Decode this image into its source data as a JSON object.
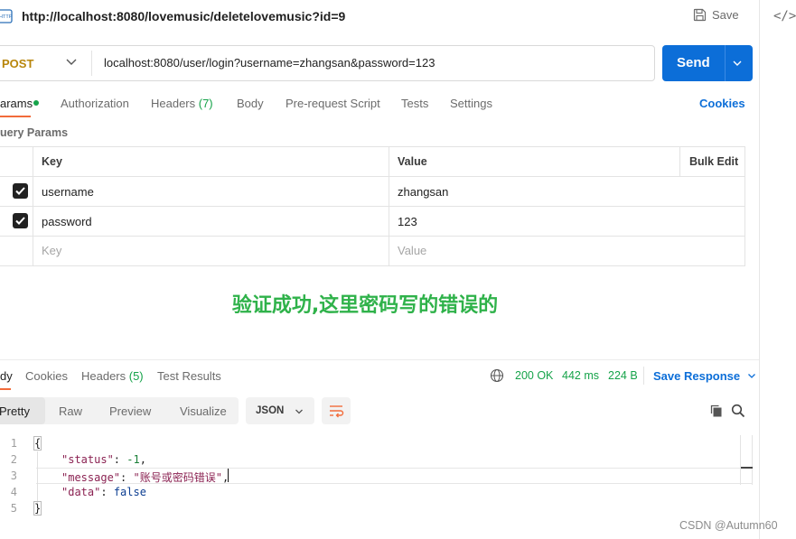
{
  "header": {
    "title": "http://localhost:8080/lovemusic/deletelovemusic?id=9",
    "save_label": "Save",
    "code_icon_text": "</>"
  },
  "request": {
    "method": "POST",
    "url": "localhost:8080/user/login?username=zhangsan&password=123",
    "send_label": "Send"
  },
  "tabs": [
    {
      "label": "arams",
      "count": ""
    },
    {
      "label": "Authorization",
      "count": ""
    },
    {
      "label": "Headers ",
      "count": "(7)"
    },
    {
      "label": "Body",
      "count": ""
    },
    {
      "label": "Pre-request Script",
      "count": ""
    },
    {
      "label": "Tests",
      "count": ""
    },
    {
      "label": "Settings",
      "count": ""
    }
  ],
  "cookies_label": "Cookies",
  "query_params": {
    "title": "uery Params",
    "headers": {
      "key": "Key",
      "value": "Value",
      "bulk": "Bulk Edit"
    },
    "rows": [
      {
        "key": "username",
        "value": "zhangsan",
        "checked": true
      },
      {
        "key": "password",
        "value": "123",
        "checked": true
      }
    ],
    "placeholder": {
      "key": "Key",
      "value": "Value"
    }
  },
  "annotation": "验证成功,这里密码写的错误的",
  "response": {
    "tabs": [
      {
        "label": "dy",
        "count": ""
      },
      {
        "label": "Cookies",
        "count": ""
      },
      {
        "label": "Headers ",
        "count": "(5)"
      },
      {
        "label": "Test Results",
        "count": ""
      }
    ],
    "status": "200 OK",
    "time": "442 ms",
    "size": "224 B",
    "save_response": "Save Response",
    "views": [
      "Pretty",
      "Raw",
      "Preview",
      "Visualize"
    ],
    "format": "JSON",
    "code_lines": [
      "1",
      "2",
      "3",
      "4",
      "5"
    ],
    "body": {
      "open": "{",
      "status_key": "\"status\"",
      "status_val": "-1",
      "message_key": "\"message\"",
      "message_val": "\"账号或密码错误\"",
      "data_key": "\"data\"",
      "data_val": "false",
      "close": "}"
    }
  },
  "watermark": "CSDN @Autumn60",
  "colors": {
    "accent_blue": "#0c6ed8",
    "method_post": "#b8860b",
    "status_green": "#16a34a",
    "tab_underline": "#f26b3a",
    "annotation_green": "#2fb24a"
  }
}
